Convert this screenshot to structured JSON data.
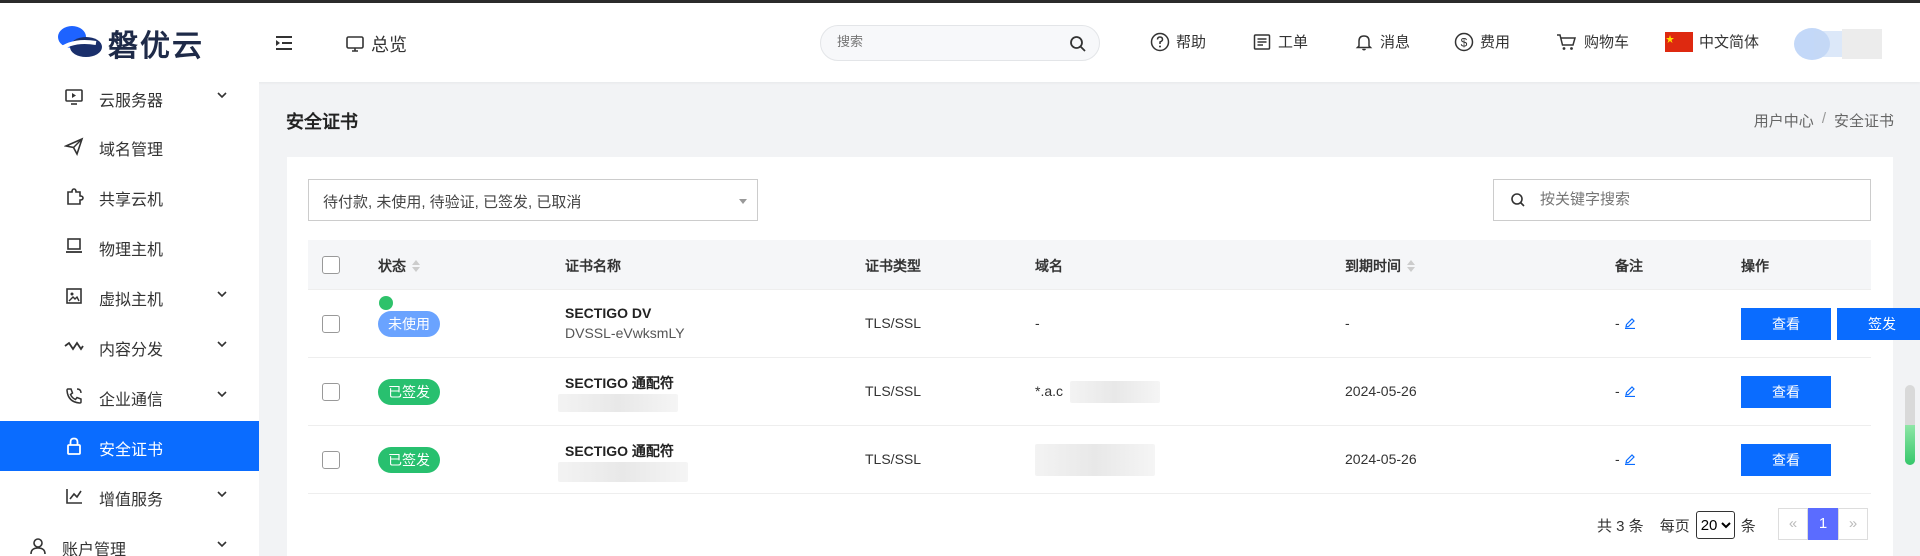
{
  "header": {
    "logo_text": "磐优云",
    "overview_label": "总览",
    "search_placeholder": "搜索",
    "nav": [
      {
        "label": "帮助",
        "icon": "help-circle-icon"
      },
      {
        "label": "工单",
        "icon": "ticket-icon"
      },
      {
        "label": "消息",
        "icon": "bell-icon"
      },
      {
        "label": "费用",
        "icon": "dollar-icon"
      },
      {
        "label": "购物车",
        "icon": "cart-icon"
      },
      {
        "label": "中文简体",
        "icon": "china-flag-icon"
      }
    ]
  },
  "sidebar": {
    "items": [
      {
        "label": "云服务器",
        "icon": "monitor-icon",
        "has_children": true
      },
      {
        "label": "域名管理",
        "icon": "send-icon",
        "has_children": false
      },
      {
        "label": "共享云机",
        "icon": "puzzle-icon",
        "has_children": false
      },
      {
        "label": "物理主机",
        "icon": "laptop-icon",
        "has_children": false
      },
      {
        "label": "虚拟主机",
        "icon": "image-icon",
        "has_children": true
      },
      {
        "label": "内容分发",
        "icon": "wave-icon",
        "has_children": true
      },
      {
        "label": "企业通信",
        "icon": "phone-icon",
        "has_children": true
      },
      {
        "label": "安全证书",
        "icon": "lock-icon",
        "has_children": false,
        "active": true
      },
      {
        "label": "增值服务",
        "icon": "chart-icon",
        "has_children": true
      },
      {
        "label": "账户管理",
        "icon": "user-icon",
        "has_children": true
      }
    ]
  },
  "page": {
    "title": "安全证书",
    "breadcrumb": [
      "用户中心",
      "/",
      "安全证书"
    ]
  },
  "filters": {
    "status_value": "待付款, 未使用, 待验证, 已签发, 已取消",
    "keyword_placeholder": "按关键字搜索"
  },
  "table": {
    "headers": {
      "status": "状态",
      "name": "证书名称",
      "type": "证书类型",
      "domain": "域名",
      "expiry": "到期时间",
      "note": "备注",
      "actions": "操作"
    },
    "rows": [
      {
        "status": "未使用",
        "status_color": "#6aa3ff",
        "name": "SECTIGO DV",
        "sub": "DVSSL-eVwksmLY",
        "type": "TLS/SSL",
        "domain": "-",
        "expiry": "-",
        "note": "-",
        "actions": [
          "查看",
          "签发"
        ]
      },
      {
        "status": "已签发",
        "status_color": "#28c06f",
        "name": "SECTIGO 通配符",
        "sub": "",
        "type": "TLS/SSL",
        "domain": "*.a.c",
        "expiry": "2024-05-26",
        "note": "-",
        "actions": [
          "查看"
        ]
      },
      {
        "status": "已签发",
        "status_color": "#28c06f",
        "name": "SECTIGO 通配符",
        "sub": "",
        "type": "TLS/SSL",
        "domain": "",
        "expiry": "2024-05-26",
        "note": "-",
        "actions": [
          "查看"
        ]
      }
    ]
  },
  "pagination": {
    "total_text": "共 3 条",
    "per_page_label": "每页",
    "per_page_value": "20",
    "unit": "条",
    "prev": "«",
    "current": "1",
    "next": "»"
  },
  "colors": {
    "primary": "#0a6cff",
    "success": "#28c06f",
    "info": "#6aa3ff"
  }
}
